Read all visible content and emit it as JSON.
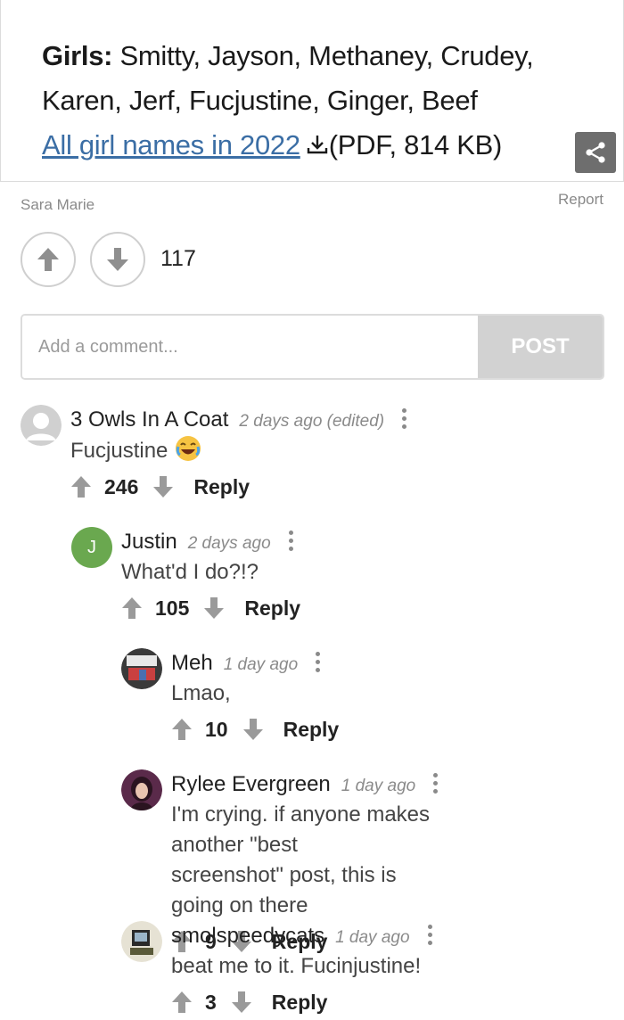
{
  "embedded_card": {
    "label": "Girls:",
    "names": "Smitty, Jayson, Methaney, Crudey, Karen, Jerf, Fucjustine, Ginger, Beef",
    "link_text": "All girl names in 2022",
    "file_info": "(PDF, 814 KB)"
  },
  "post": {
    "author": "Sara Marie",
    "report_label": "Report",
    "score": "117"
  },
  "comment_form": {
    "placeholder": "Add a comment...",
    "post_label": "POST"
  },
  "comments": [
    {
      "user": "3 Owls In A Coat",
      "time": "2 days ago (edited)",
      "text": "Fucjustine",
      "score": "246",
      "reply_label": "Reply"
    },
    {
      "user": "Justin",
      "avatar_letter": "J",
      "time": "2 days ago",
      "text": "What'd I do?!?",
      "score": "105",
      "reply_label": "Reply"
    },
    {
      "user": "Meh",
      "time": "1 day ago",
      "text": "Lmao,",
      "score": "10",
      "reply_label": "Reply"
    },
    {
      "user": "Rylee Evergreen",
      "time": "1 day ago",
      "text_line1": "I'm crying. if anyone makes another \"best",
      "text_line2": "screenshot\" post, this is going on there",
      "score": "9",
      "reply_label": "Reply"
    },
    {
      "user": "smolspeedycats",
      "time": "1 day ago",
      "text": "beat me to it. Fucinjustine!",
      "score": "3",
      "reply_label": "Reply"
    }
  ],
  "colors": {
    "link": "#3b6ea5",
    "post_button": "#d2d2d2",
    "justin_avatar": "#6aa84f",
    "muted": "#8a8a8a"
  }
}
